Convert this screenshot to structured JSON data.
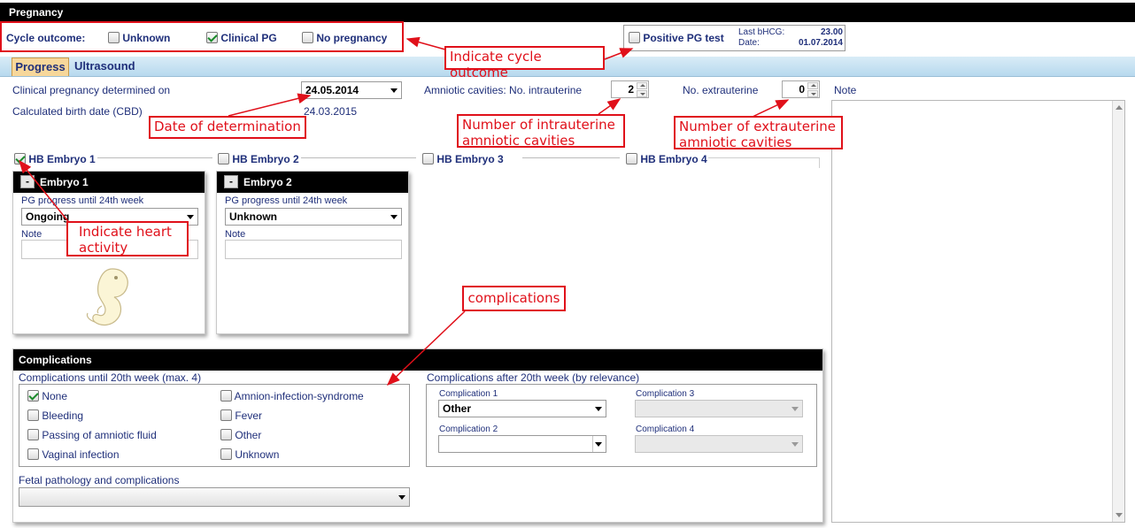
{
  "window": {
    "title": "Pregnancy"
  },
  "cycle_outcome": {
    "label": "Cycle outcome:",
    "options": [
      {
        "label": "Unknown",
        "checked": false
      },
      {
        "label": "Clinical PG",
        "checked": true
      },
      {
        "label": "No pregnancy",
        "checked": false
      }
    ]
  },
  "pg_test": {
    "label": "Positive PG test",
    "checked": false,
    "last_bhcg_label": "Last bHCG:",
    "last_bhcg_value": "23.00",
    "date_label": "Date:",
    "date_value": "01.07.2014"
  },
  "tabs": [
    {
      "label": "Progress",
      "active": true
    },
    {
      "label": "Ultrasound",
      "active": false
    }
  ],
  "progress": {
    "clinical_pg_label": "Clinical pregnancy determined on",
    "clinical_pg_date": "24.05.2014",
    "cbd_label": "Calculated birth date (CBD)",
    "cbd_value": "24.03.2015",
    "amniotic_label": "Amniotic cavities:  No. intrauterine",
    "intrauterine_value": "2",
    "extrauterine_label": "No. extrauterine",
    "extrauterine_value": "0",
    "note_label": "Note"
  },
  "hb_embryos": [
    {
      "label": "HB Embryo 1",
      "checked": true
    },
    {
      "label": "HB Embryo 2",
      "checked": false
    },
    {
      "label": "HB Embryo 3",
      "checked": false
    },
    {
      "label": "HB Embryo 4",
      "checked": false
    }
  ],
  "embryo_panels": [
    {
      "collapse": "-",
      "title": "Embryo 1",
      "progress_label": "PG progress until 24th week",
      "progress_value": "Ongoing",
      "note_label": "Note"
    },
    {
      "collapse": "-",
      "title": "Embryo 2",
      "progress_label": "PG progress until 24th week",
      "progress_value": "Unknown",
      "note_label": "Note"
    }
  ],
  "complications": {
    "title": "Complications",
    "until20_label": "Complications until 20th week (max. 4)",
    "until20_items": [
      {
        "label": "None",
        "checked": true
      },
      {
        "label": "Amnion-infection-syndrome",
        "checked": false
      },
      {
        "label": "Bleeding",
        "checked": false
      },
      {
        "label": "Fever",
        "checked": false
      },
      {
        "label": "Passing of amniotic fluid",
        "checked": false
      },
      {
        "label": "Other",
        "checked": false
      },
      {
        "label": "Vaginal infection",
        "checked": false
      },
      {
        "label": "Unknown",
        "checked": false
      }
    ],
    "after20_label": "Complications after 20th week  (by relevance)",
    "after20": [
      {
        "label": "Complication 1",
        "value": "Other"
      },
      {
        "label": "Complication 2",
        "value": ""
      },
      {
        "label": "Complication 3",
        "value": ""
      },
      {
        "label": "Complication 4",
        "value": ""
      }
    ],
    "fetal_label": "Fetal pathology and complications",
    "fetal_value": ""
  },
  "annotations": {
    "cycle_outcome": "Indicate cycle outcome",
    "date_determination": "Date of determination",
    "intrauterine_1": "Number of intrauterine",
    "intrauterine_2": "amniotic cavities",
    "extrauterine_1": "Number of extrauterine",
    "extrauterine_2": "amniotic cavities",
    "heart_1": "Indicate heart",
    "heart_2": "activity",
    "complications": "complications"
  },
  "colors": {
    "annotation": "#e0101a",
    "label_text": "#1f2f7a",
    "titlebar": "#000000",
    "active_tab": "#f7d79a"
  },
  "icons": {
    "embryo_illustration": "embryo-icon",
    "check": "check-icon"
  }
}
